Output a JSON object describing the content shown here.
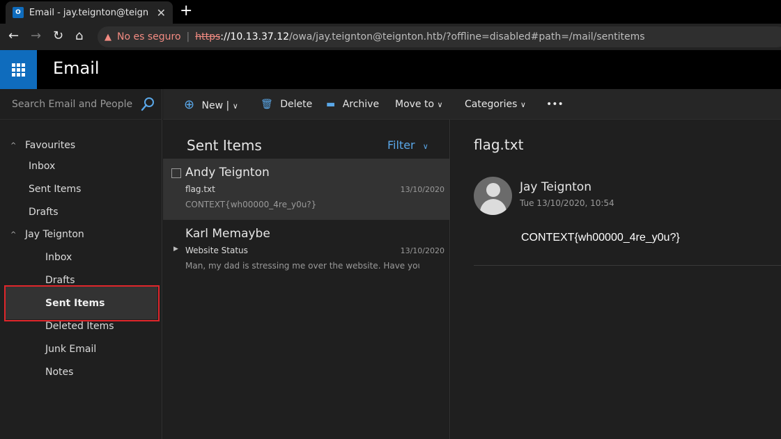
{
  "browser": {
    "tab_title": "Email - jay.teignton@teign",
    "tab_favicon_text": "O",
    "security_label": "No es seguro",
    "url_scheme": "https",
    "url_host": "://10.13.37.12",
    "url_path": "/owa/jay.teignton@teignton.htb/?offline=disabled#path=/mail/sentitems"
  },
  "app": {
    "title": "Email"
  },
  "search": {
    "placeholder": "Search Email and People"
  },
  "nav": {
    "favourites_label": "Favourites",
    "favourites": [
      "Inbox",
      "Sent Items",
      "Drafts"
    ],
    "account_label": "Jay Teignton",
    "account_folders": [
      "Inbox",
      "Drafts",
      "Sent Items",
      "Deleted Items",
      "Junk Email",
      "Notes"
    ],
    "selected": "Sent Items"
  },
  "toolbar": {
    "new_label": "New",
    "delete_label": "Delete",
    "archive_label": "Archive",
    "moveto_label": "Move to",
    "categories_label": "Categories",
    "more_label": "•••"
  },
  "list": {
    "header": "Sent Items",
    "filter_label": "Filter",
    "messages": [
      {
        "from": "Andy Teignton",
        "subject": "flag.txt",
        "date": "13/10/2020",
        "preview": "CONTEXT{wh00000_4re_y0u?}"
      },
      {
        "from": "Karl Memaybe",
        "subject": "Website Status",
        "date": "13/10/2020",
        "preview": "Man, my dad is stressing me over the website. Have you ..."
      }
    ]
  },
  "reading": {
    "subject": "flag.txt",
    "from": "Jay Teignton",
    "date": "Tue 13/10/2020, 10:54",
    "body": "CONTEXT{wh00000_4re_y0u?}"
  },
  "colors": {
    "accent": "#0f6cbd",
    "link": "#5aa7e8",
    "highlight_box": "#e0262b"
  }
}
